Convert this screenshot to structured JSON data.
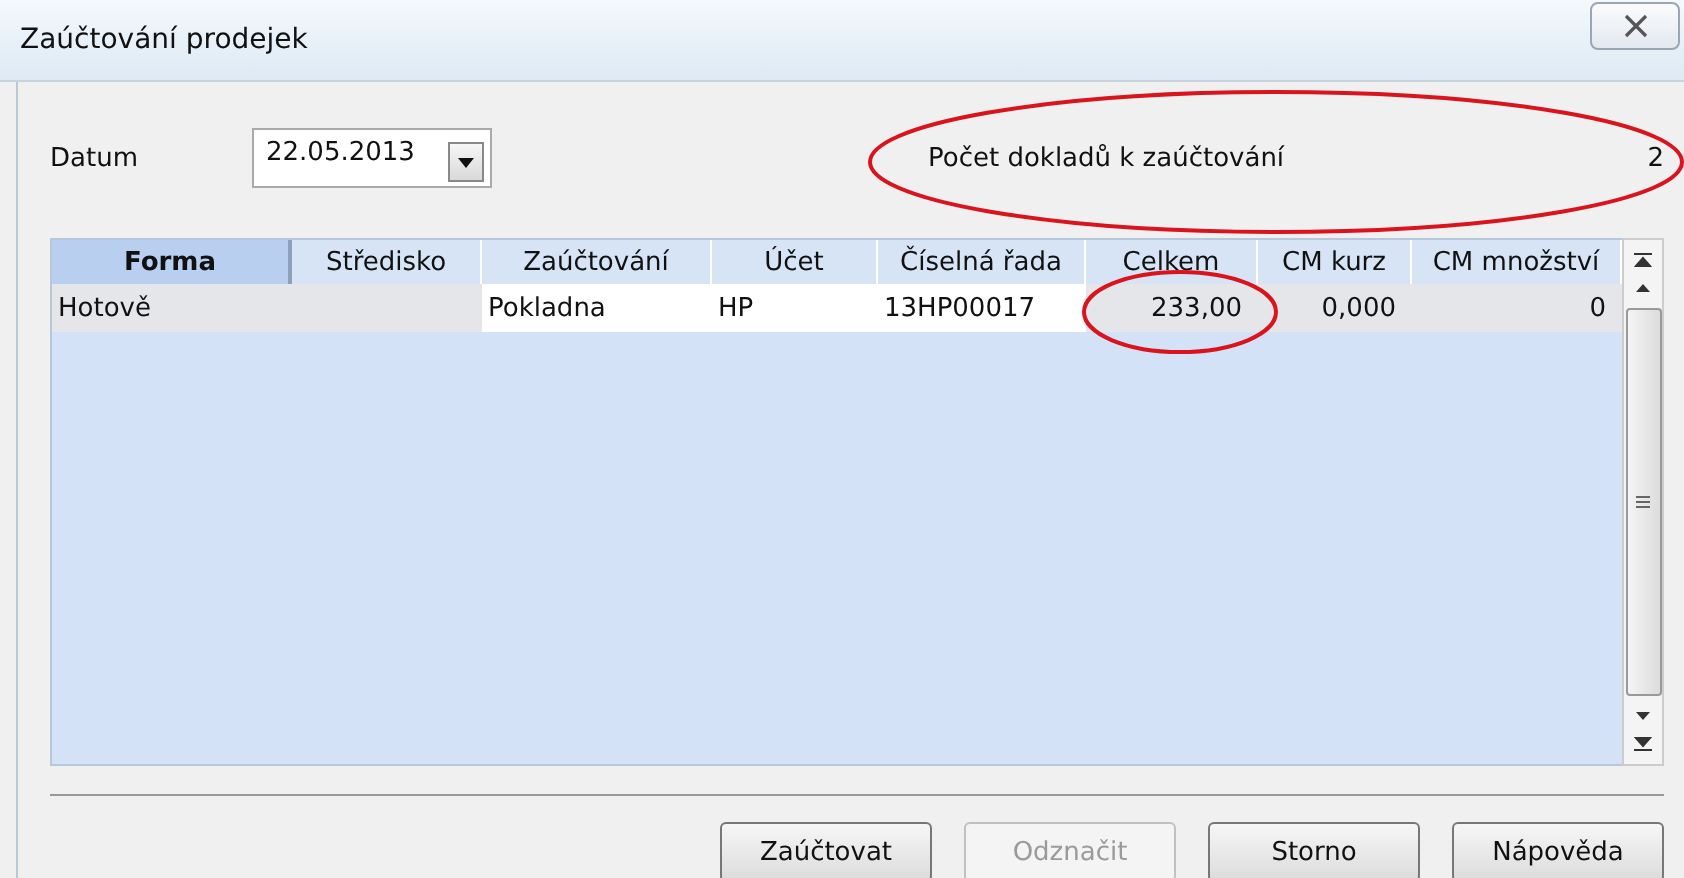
{
  "window": {
    "title": "Zaúčtování prodejek"
  },
  "date": {
    "label": "Datum",
    "value": "22.05.2013"
  },
  "count": {
    "label": "Počet dokladů k zaúčtování",
    "value": "2"
  },
  "table": {
    "columns": [
      {
        "label": "Forma",
        "selected": true
      },
      {
        "label": "Středisko",
        "selected": false
      },
      {
        "label": "Zaúčtování",
        "selected": false
      },
      {
        "label": "Účet",
        "selected": false
      },
      {
        "label": "Číselná řada",
        "selected": false
      },
      {
        "label": "Celkem",
        "selected": false
      },
      {
        "label": "CM kurz",
        "selected": false
      },
      {
        "label": "CM množství",
        "selected": false
      }
    ],
    "rows": [
      {
        "cells": [
          {
            "text": "Hotově",
            "editable": false
          },
          {
            "editable": false
          },
          {
            "text": "Pokladna",
            "editable": true
          },
          {
            "text": "HP",
            "editable": true
          },
          {
            "text": "13HP00017",
            "editable": true
          },
          {
            "text": "233,00",
            "editable": false
          },
          {
            "text": "0,000",
            "editable": false
          },
          {
            "text": "0",
            "editable": false
          }
        ]
      }
    ]
  },
  "buttons": [
    {
      "label": "Zaúčtovat",
      "disabled": false
    },
    {
      "label": "Odznačit",
      "disabled": true
    },
    {
      "label": "Storno",
      "disabled": false
    },
    {
      "label": "Nápověda",
      "disabled": false
    }
  ]
}
